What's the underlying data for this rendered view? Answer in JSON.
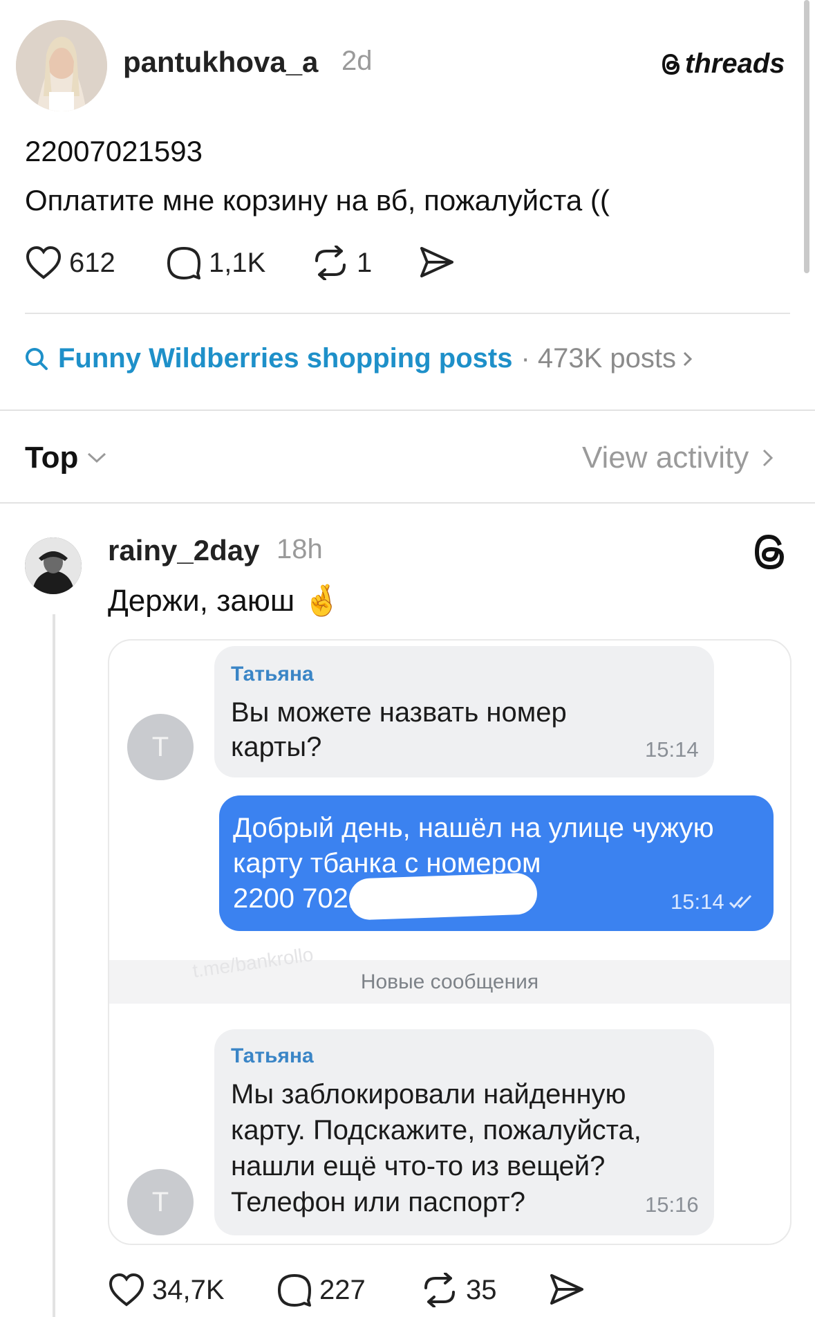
{
  "post": {
    "username": "pantukhova_a",
    "time": "2d",
    "brand": "threads",
    "line1": "22007021593",
    "line2": "Оплатите мне корзину на вб, пожалуйста ((",
    "likes": "612",
    "comments": "1,1K",
    "reposts": "1"
  },
  "topic": {
    "title": "Funny Wildberries shopping posts",
    "meta": "· 473K posts"
  },
  "sort": {
    "label": "Top",
    "view_activity": "View activity"
  },
  "reply": {
    "username": "rainy_2day",
    "time": "18h",
    "text": "Держи, заюш 🤞",
    "likes": "34,7K",
    "comments": "227",
    "reposts": "35"
  },
  "chat": {
    "msg1_sender": "Татьяна",
    "msg1_line1": "Вы можете назвать номер",
    "msg1_line2": "карты?",
    "msg1_time": "15:14",
    "msg2_line1": "Добрый день, нашёл на улице чужую",
    "msg2_line2": "карту тбанка с номером",
    "msg2_line3": "2200 7021",
    "msg2_time": "15:14",
    "new_messages": "Новые сообщения",
    "msg3_sender": "Татьяна",
    "msg3_line1": "Мы заблокировали найденную",
    "msg3_line2": "карту. Подскажите, пожалуйста,",
    "msg3_line3": "нашли ещё что-то из вещей?",
    "msg3_line4": "Телефон или паспорт?",
    "msg3_time": "15:16",
    "avatar_letter": "Т",
    "watermark": "t.me/bankrollo"
  },
  "colors": {
    "accent": "#1e90c9",
    "bubble_out": "#3b82f0",
    "bubble_in": "#eff0f2"
  }
}
